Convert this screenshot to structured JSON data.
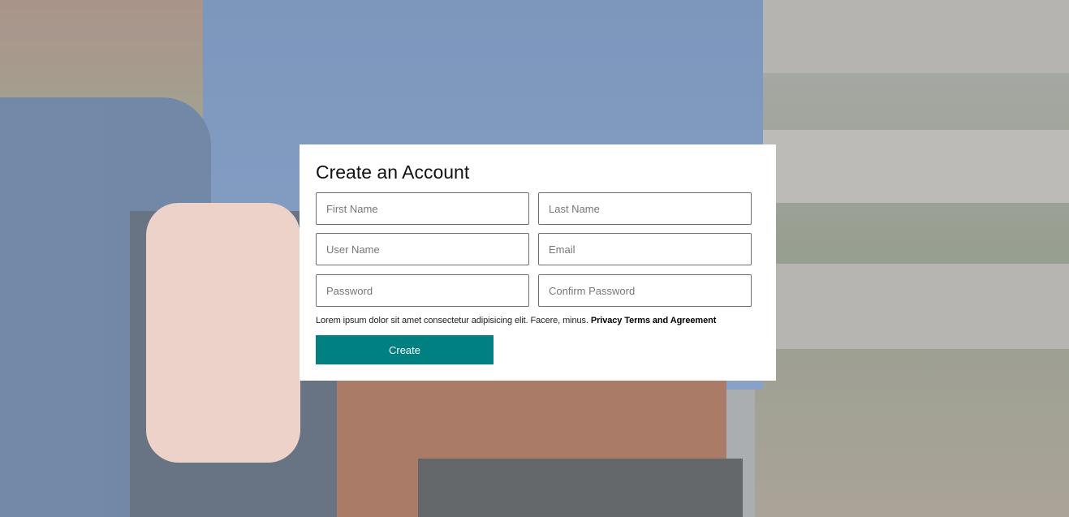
{
  "form": {
    "title": "Create an Account",
    "fields": {
      "first_name": "First Name",
      "last_name": "Last Name",
      "user_name": "User Name",
      "email": "Email",
      "password": "Password",
      "confirm_password": "Confirm Password"
    },
    "terms_text": "Lorem ipsum dolor sit amet consectetur adipisicing elit. Facere, minus.",
    "terms_link": "Privacy Terms and Agreement",
    "submit_label": "Create"
  },
  "colors": {
    "accent": "#008080"
  }
}
